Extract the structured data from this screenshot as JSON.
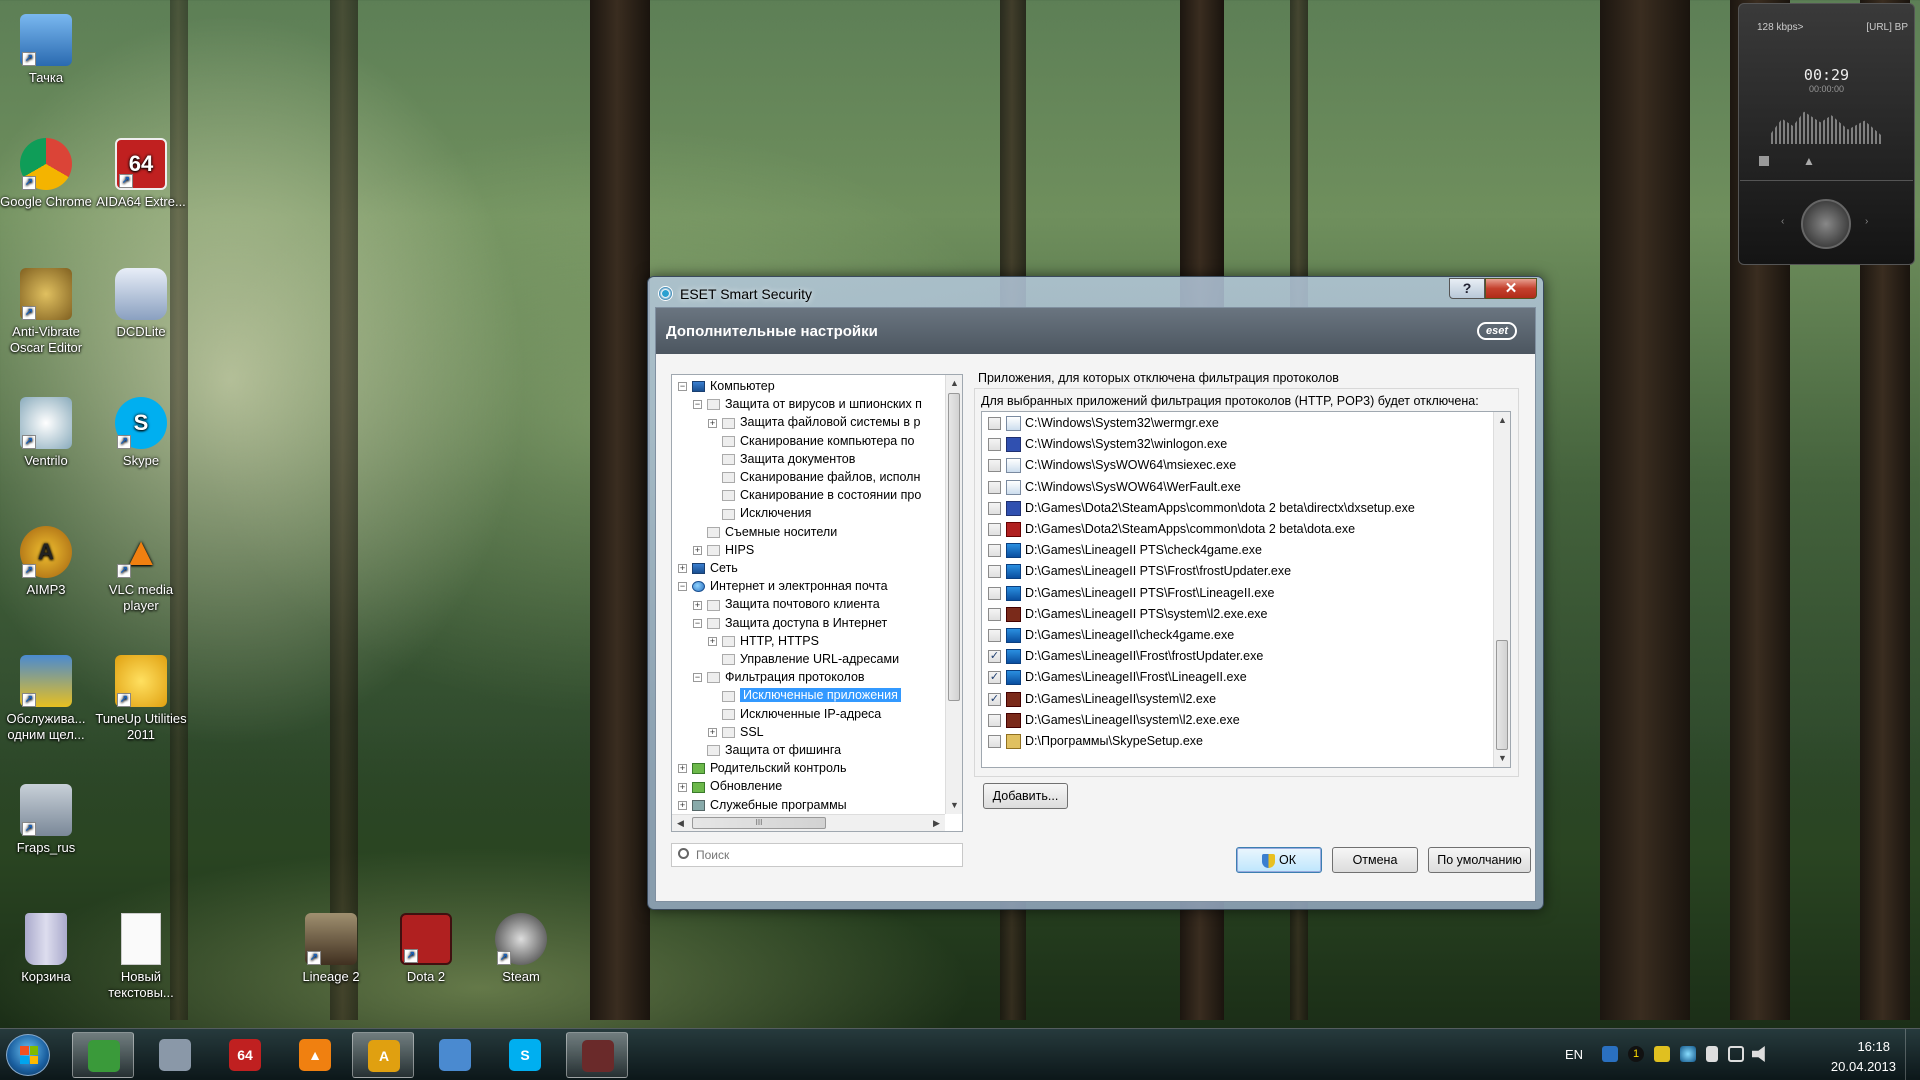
{
  "desktop": {
    "icons": [
      {
        "label": "Тачка"
      },
      {
        "label": "Google Chrome"
      },
      {
        "label": "AIDA64 Extre..."
      },
      {
        "label": "Anti-Vibrate Oscar Editor"
      },
      {
        "label": "DCDLite"
      },
      {
        "label": "Ventrilo"
      },
      {
        "label": "Skype"
      },
      {
        "label": "AIMP3"
      },
      {
        "label": "VLC media player"
      },
      {
        "label": "Обслужива... одним щел..."
      },
      {
        "label": "TuneUp Utilities 2011"
      },
      {
        "label": "Fraps_rus"
      },
      {
        "label": "Корзина"
      },
      {
        "label": "Новый текстовы..."
      },
      {
        "label": "Lineage 2"
      },
      {
        "label": "Dota 2"
      },
      {
        "label": "Steam"
      }
    ]
  },
  "gadget": {
    "bitrate": "128 kbps>",
    "tag": "[URL] BP",
    "time": "00:29",
    "time2": "00:00:00"
  },
  "window": {
    "title": "ESET Smart Security",
    "help_label": "?",
    "close_label": "✕",
    "header_title": "Дополнительные настройки",
    "logo": "eset",
    "tree": [
      {
        "label": "Компьютер",
        "expander": "−",
        "icon": "monitor-icon"
      },
      {
        "label": "Защита от вирусов и шпионских п",
        "expander": "−",
        "icon": "page-icon"
      },
      {
        "label": "Защита файловой системы в р",
        "expander": "+",
        "icon": "page-icon"
      },
      {
        "label": "Сканирование компьютера по",
        "expander": "",
        "icon": "page-icon"
      },
      {
        "label": "Защита документов",
        "expander": "",
        "icon": "page-icon"
      },
      {
        "label": "Сканирование файлов, исполн",
        "expander": "",
        "icon": "page-icon"
      },
      {
        "label": "Сканирование в состоянии про",
        "expander": "",
        "icon": "page-icon"
      },
      {
        "label": "Исключения",
        "expander": "",
        "icon": "page-icon"
      },
      {
        "label": "Съемные носители",
        "expander": "",
        "icon": "page-icon"
      },
      {
        "label": "HIPS",
        "expander": "+",
        "icon": "page-icon"
      },
      {
        "label": "Сеть",
        "expander": "+",
        "icon": "monitor-icon"
      },
      {
        "label": "Интернет и электронная почта",
        "expander": "−",
        "icon": "globe-icon"
      },
      {
        "label": "Защита почтового клиента",
        "expander": "+",
        "icon": "page-icon"
      },
      {
        "label": "Защита доступа в Интернет",
        "expander": "−",
        "icon": "page-icon"
      },
      {
        "label": "HTTP, HTTPS",
        "expander": "+",
        "icon": "page-icon"
      },
      {
        "label": "Управление URL-адресами",
        "expander": "",
        "icon": "page-icon"
      },
      {
        "label": "Фильтрация протоколов",
        "expander": "−",
        "icon": "page-icon"
      },
      {
        "label": "Исключенные приложения",
        "expander": "",
        "icon": "page-icon",
        "selected": true
      },
      {
        "label": "Исключенные IP-адреса",
        "expander": "",
        "icon": "page-icon"
      },
      {
        "label": "SSL",
        "expander": "+",
        "icon": "page-icon"
      },
      {
        "label": "Защита от фишинга",
        "expander": "",
        "icon": "page-icon"
      },
      {
        "label": "Родительский контроль",
        "expander": "+",
        "icon": "green-icon"
      },
      {
        "label": "Обновление",
        "expander": "+",
        "icon": "green-icon"
      },
      {
        "label": "Служебные программы",
        "expander": "+",
        "icon": "tools-icon"
      }
    ],
    "search_placeholder": "Поиск",
    "section_title": "Приложения, для которых отключена фильтрация протоколов",
    "description": "Для выбранных приложений фильтрация протоколов (HTTP, POP3) будет отключена:",
    "apps": [
      {
        "path": "C:\\Windows\\System32\\wermgr.exe",
        "checked": false,
        "icon": "w"
      },
      {
        "path": "C:\\Windows\\System32\\winlogon.exe",
        "checked": false,
        "icon": "dx"
      },
      {
        "path": "C:\\Windows\\SysWOW64\\msiexec.exe",
        "checked": false,
        "icon": "w"
      },
      {
        "path": "C:\\Windows\\SysWOW64\\WerFault.exe",
        "checked": false,
        "icon": "w"
      },
      {
        "path": "D:\\Games\\Dota2\\SteamApps\\common\\dota 2 beta\\directx\\dxsetup.exe",
        "checked": false,
        "icon": "dx"
      },
      {
        "path": "D:\\Games\\Dota2\\SteamApps\\common\\dota 2 beta\\dota.exe",
        "checked": false,
        "icon": "red"
      },
      {
        "path": "D:\\Games\\LineageII PTS\\check4game.exe",
        "checked": false,
        "icon": "sh"
      },
      {
        "path": "D:\\Games\\LineageII PTS\\Frost\\frostUpdater.exe",
        "checked": false,
        "icon": "sh"
      },
      {
        "path": "D:\\Games\\LineageII PTS\\Frost\\LineageII.exe",
        "checked": false,
        "icon": "sh"
      },
      {
        "path": "D:\\Games\\LineageII PTS\\system\\l2.exe.exe",
        "checked": false,
        "icon": "l2"
      },
      {
        "path": "D:\\Games\\LineageII\\check4game.exe",
        "checked": false,
        "icon": "sh"
      },
      {
        "path": "D:\\Games\\LineageII\\Frost\\frostUpdater.exe",
        "checked": true,
        "icon": "sh"
      },
      {
        "path": "D:\\Games\\LineageII\\Frost\\LineageII.exe",
        "checked": true,
        "icon": "sh"
      },
      {
        "path": "D:\\Games\\LineageII\\system\\l2.exe",
        "checked": true,
        "icon": "l2"
      },
      {
        "path": "D:\\Games\\LineageII\\system\\l2.exe.exe",
        "checked": false,
        "icon": "l2"
      },
      {
        "path": "D:\\Программы\\SkypeSetup.exe",
        "checked": false,
        "icon": "sk"
      }
    ],
    "add_label": "Добавить...",
    "ok_label": "ОК",
    "cancel_label": "Отмена",
    "default_label": "По умолчанию",
    "tree_hscroll_grip": "III"
  },
  "taskbar": {
    "buttons": [
      {
        "name": "chrome",
        "active": true,
        "glyph": "",
        "color": "#3a9a3a"
      },
      {
        "name": "fraps",
        "active": false,
        "glyph": "",
        "color": "#8a98a8"
      },
      {
        "name": "aida64",
        "active": false,
        "glyph": "64",
        "color": "#c02020"
      },
      {
        "name": "vlc",
        "active": false,
        "glyph": "▲",
        "color": "#f08010"
      },
      {
        "name": "aimp",
        "active": true,
        "glyph": "A",
        "color": "#e0a010"
      },
      {
        "name": "ventrilo",
        "active": false,
        "glyph": "",
        "color": "#4a8ad0"
      },
      {
        "name": "skype",
        "active": false,
        "glyph": "S",
        "color": "#00aff0"
      },
      {
        "name": "lineage",
        "active": true,
        "glyph": "",
        "color": "#6a2a2a"
      }
    ],
    "language": "EN",
    "time": "16:18",
    "date": "20.04.2013",
    "tray_badge": "1"
  },
  "colors": {
    "selection": "#3399ff",
    "header": "#5a6570",
    "close": "#c4402c"
  }
}
